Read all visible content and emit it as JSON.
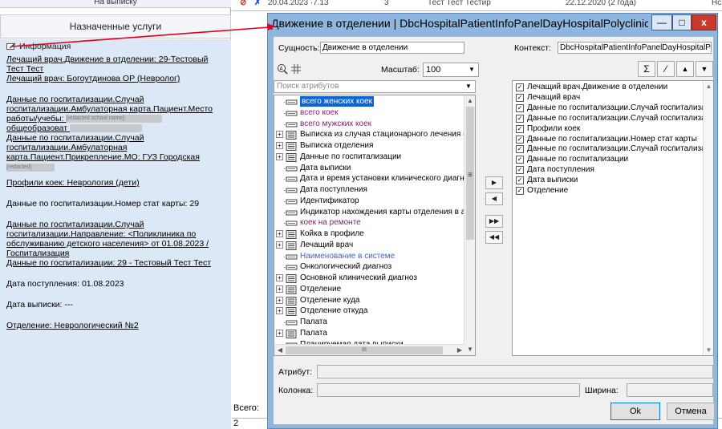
{
  "left_panel": {
    "top_text": "На выписку",
    "tab_label": "Назначенные услуги",
    "info_header": "Информация",
    "lines": [
      "Лечащий врач.Движение в отделении: 29-Тестовый Тест Тест",
      "Лечащий врач: Богоутдинова ОР (Невролог)"
    ],
    "lines2": [
      "Данные по госпитализации.Случай госпитализации.Амбулаторная карта.Пациент.Место работы/учебы:",
      "общеобразоват",
      "Данные по госпитализации.Случай госпитализации.Амбулаторная карта.Пациент.Прикрепление.МО: ГУЗ Городская"
    ],
    "redacted_1": "[redacted school name]",
    "redacted_2": "[redacted]",
    "profile": "Профили коек: Неврология (дети)",
    "stat_card": "Данные по госпитализации.Номер стат карты: 29",
    "direction": "Данные по госпитализации.Случай госпитализации.Направление: <Поликлиника по обслуживанию детского населения> от 01.08.2023 / Госпитализация",
    "hosp_data": "Данные по госпитализации: 29 - Тестовый Тест Тест",
    "admission": "Дата поступления: 01.08.2023",
    "discharge": "Дата выписки: ---",
    "department": "Отделение: Неврологический №2"
  },
  "background": {
    "top_cells": [
      "20.04.2023 ·7.13",
      "3",
      "Тест Тест Тестир",
      "22.12.2020 (2 года)",
      "Нс"
    ],
    "total_label": "Всего:",
    "total_value": "2"
  },
  "dialog": {
    "title": "Движение в отделении | DbcHospitalPatientInfoPanelDayHospitalPolyclinicWo...",
    "min_label": "—",
    "max_label": "□",
    "close_label": "x",
    "entity_label": "Сущность:",
    "entity_value": "Движение в отделении",
    "scale_label": "Масштаб:",
    "scale_value": "100",
    "search_placeholder": "Поиск атрибутов",
    "context_label": "Контекст:",
    "context_value": "DbcHospitalPatientInfoPanelDayHospitalPolycl",
    "tree": [
      {
        "label": "всего женских коек",
        "kind": "field",
        "color": "#7b1e6e",
        "expand": false,
        "selected": true
      },
      {
        "label": "всего коек",
        "kind": "field",
        "color": "#7b1e6e",
        "expand": false,
        "selected": false
      },
      {
        "label": "всего мужских коек",
        "kind": "field",
        "color": "#7b1e6e",
        "expand": false,
        "selected": false
      },
      {
        "label": "Выписка из случая стационарного лечения в с",
        "kind": "link",
        "color": "#000000",
        "expand": true,
        "selected": false
      },
      {
        "label": "Выписка отделения",
        "kind": "link",
        "color": "#000000",
        "expand": true,
        "selected": false
      },
      {
        "label": "Данные по госпитализации",
        "kind": "link",
        "color": "#000000",
        "expand": true,
        "selected": false
      },
      {
        "label": "Дата выписки",
        "kind": "field",
        "color": "#000000",
        "expand": false,
        "selected": false
      },
      {
        "label": "Дата и время установки клинического диагнс",
        "kind": "field",
        "color": "#000000",
        "expand": false,
        "selected": false
      },
      {
        "label": "Дата поступления",
        "kind": "field",
        "color": "#000000",
        "expand": false,
        "selected": false
      },
      {
        "label": "Идентификатор",
        "kind": "field",
        "color": "#000000",
        "expand": false,
        "selected": false
      },
      {
        "label": "Индикатор нахождения карты отделения в ар",
        "kind": "field",
        "color": "#000000",
        "expand": false,
        "selected": false
      },
      {
        "label": "коек на ремонте",
        "kind": "field",
        "color": "#7b1e6e",
        "expand": false,
        "selected": false
      },
      {
        "label": "Койка в профиле",
        "kind": "link",
        "color": "#000000",
        "expand": true,
        "selected": false
      },
      {
        "label": "Лечащий врач",
        "kind": "link",
        "color": "#000000",
        "expand": true,
        "selected": false
      },
      {
        "label": "Наименование в системе",
        "kind": "field",
        "color": "#3a66c6",
        "expand": false,
        "selected": false
      },
      {
        "label": "Онкологический диагноз",
        "kind": "field",
        "color": "#000000",
        "expand": false,
        "selected": false
      },
      {
        "label": "Основной клинический диагноз",
        "kind": "link",
        "color": "#000000",
        "expand": true,
        "selected": false
      },
      {
        "label": "Отделение",
        "kind": "link",
        "color": "#000000",
        "expand": true,
        "selected": false
      },
      {
        "label": "Отделение куда",
        "kind": "link",
        "color": "#000000",
        "expand": true,
        "selected": false
      },
      {
        "label": "Отделение откуда",
        "kind": "link",
        "color": "#000000",
        "expand": true,
        "selected": false
      },
      {
        "label": "Палата",
        "kind": "field",
        "color": "#000000",
        "expand": false,
        "selected": false
      },
      {
        "label": "Палата",
        "kind": "link",
        "color": "#000000",
        "expand": true,
        "selected": false
      },
      {
        "label": "Планируемая дата выписки",
        "kind": "field",
        "color": "#000000",
        "expand": false,
        "selected": false
      }
    ],
    "checklist": [
      "Лечащий врач.Движение в отделении",
      "Лечащий врач",
      "Данные по госпитализации.Случай госпитализа",
      "Данные по госпитализации.Случай госпитализа",
      "Профили коек",
      "Данные по госпитализации.Номер стат карты",
      "Данные по госпитализации.Случай госпитализа",
      "Данные по госпитализации",
      "Дата поступления",
      "Дата выписки",
      "Отделение"
    ],
    "mid_buttons": [
      "▶",
      "◀",
      "▶▶",
      "◀◀"
    ],
    "toolbar": [
      "Σ",
      "⁄",
      "▲",
      "▼"
    ],
    "attr_label": "Атрибут:",
    "col_label": "Колонка:",
    "width_label": "Ширина:",
    "ok_label": "Ok",
    "cancel_label": "Отмена",
    "scroll_mark": "III"
  }
}
